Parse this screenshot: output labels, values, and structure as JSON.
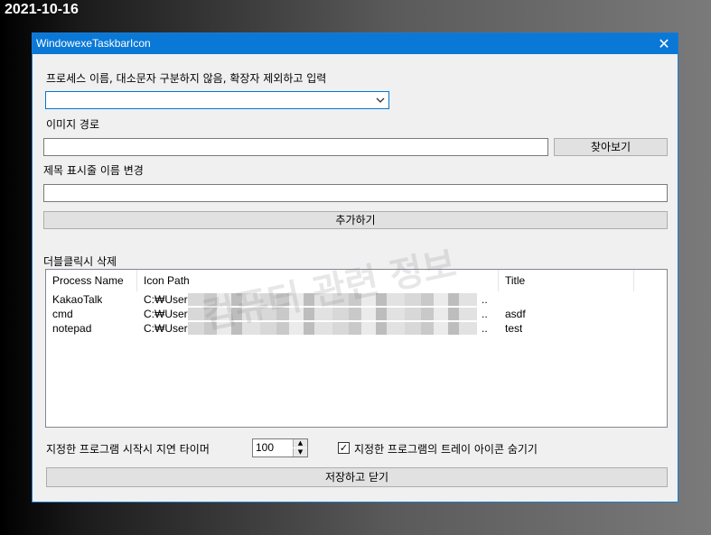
{
  "date_overlay": "2021-10-16",
  "window": {
    "title": "WindowexeTaskbarIcon",
    "close_glyph": "✕"
  },
  "process": {
    "label": "프로세스 이름, 대소문자 구분하지 않음, 확장자 제외하고 입력",
    "value": ""
  },
  "image_path": {
    "label": "이미지 경로",
    "value": "",
    "browse_label": "찾아보기"
  },
  "title_change": {
    "label": "제목 표시줄 이름 변경",
    "value": ""
  },
  "add_label": "추가하기",
  "list": {
    "label": "더블클릭시 삭제",
    "columns": [
      "Process Name",
      "Icon Path",
      "Title"
    ],
    "rows": [
      {
        "process": "KakaoTalk",
        "path": "C:₩User",
        "ellipsis": "..",
        "title": ""
      },
      {
        "process": "cmd",
        "path": "C:₩User",
        "ellipsis": "..",
        "title": "asdf"
      },
      {
        "process": "notepad",
        "path": "C:₩User",
        "ellipsis": "..",
        "title": "test"
      }
    ]
  },
  "watermark": "컴퓨터 관련 정보",
  "delay": {
    "label": "지정한 프로그램 시작시 지연 타이머",
    "value": "100"
  },
  "tray": {
    "label": "지정한 프로그램의 트레이 아이콘 숨기기",
    "checked": true
  },
  "save_label": "저장하고 닫기",
  "colors": {
    "accent": "#0a78d7"
  }
}
